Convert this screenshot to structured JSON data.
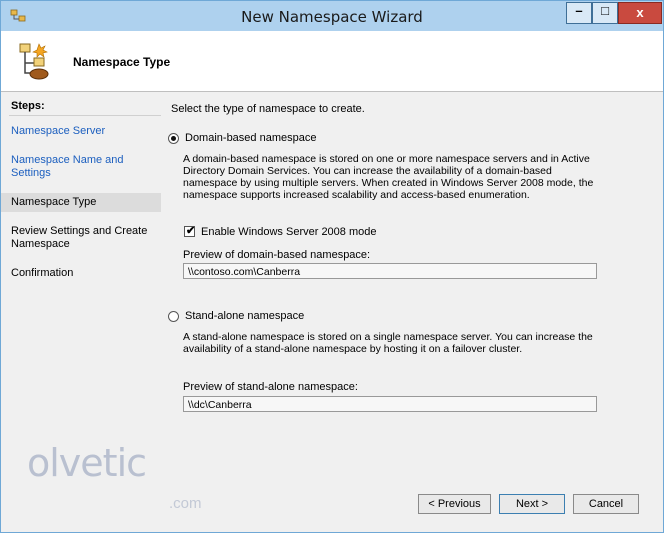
{
  "window": {
    "title": "New Namespace Wizard",
    "icons": {
      "app": "app-icon",
      "minimize": "minimize-icon",
      "maximize": "maximize-icon",
      "close": "close-icon"
    },
    "controls": {
      "minimize": "–",
      "maximize": "□",
      "close": "x"
    }
  },
  "header": {
    "title": "Namespace Type",
    "icon": "namespace-tree-icon"
  },
  "steps": {
    "title": "Steps:",
    "items": [
      {
        "label": "Namespace Server",
        "state": "link"
      },
      {
        "label": "Namespace Name and Settings",
        "state": "link"
      },
      {
        "label": "Namespace Type",
        "state": "current"
      },
      {
        "label": "Review Settings and Create Namespace",
        "state": "plain"
      },
      {
        "label": "Confirmation",
        "state": "plain"
      }
    ]
  },
  "main": {
    "intro": "Select the type of namespace to create.",
    "domain_option": {
      "label": "Domain-based namespace",
      "selected": true,
      "description": "A domain-based namespace is stored on one or more namespace servers and in Active Directory Domain Services. You can increase the availability of a domain-based namespace by using multiple servers. When created in Windows Server 2008 mode, the namespace supports increased scalability and access-based enumeration.",
      "enable_mode_label": "Enable Windows Server 2008 mode",
      "enable_mode_checked": true,
      "preview_label": "Preview of domain-based namespace:",
      "preview_value": "\\\\contoso.com\\Canberra"
    },
    "standalone_option": {
      "label": "Stand-alone namespace",
      "selected": false,
      "description": "A stand-alone namespace is stored on a single namespace server. You can increase the availability of a stand-alone namespace by hosting it on a failover cluster.",
      "preview_label": "Preview of stand-alone namespace:",
      "preview_value": "\\\\dc\\Canberra"
    }
  },
  "footer": {
    "previous": "< Previous",
    "next": "Next >",
    "cancel": "Cancel"
  },
  "watermark": {
    "text": "olvetic",
    "suffix": ".com"
  },
  "colors": {
    "titlebar": "#aed1ee",
    "link": "#1c5fbf",
    "close": "#c94a3f"
  }
}
